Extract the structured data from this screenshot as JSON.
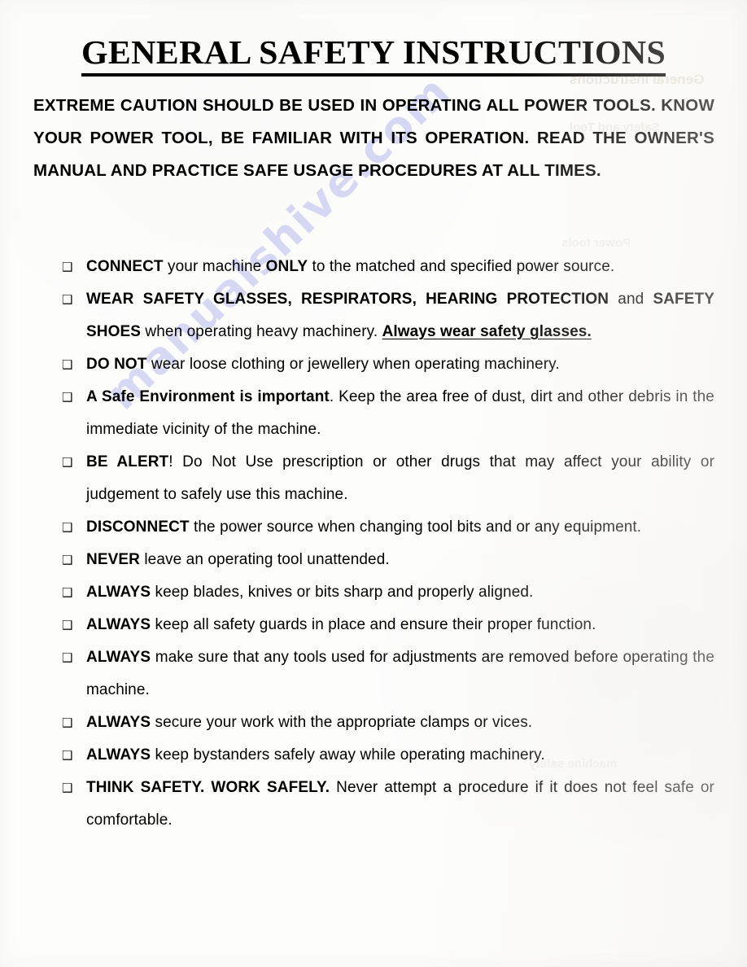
{
  "document": {
    "title": "GENERAL SAFETY INSTRUCTIONS",
    "intro": "EXTREME CAUTION SHOULD BE USED IN OPERATING ALL POWER TOOLS. KNOW YOUR POWER TOOL, BE FAMILIAR WITH ITS OPERATION. READ THE OWNER'S MANUAL AND PRACTICE SAFE USAGE PROCEDURES AT ALL TIMES.",
    "bullet_marker": "❑",
    "watermark": "manualshive.com",
    "ghost_text": {
      "line1": "General Instructions",
      "line2": "Safety and Tool",
      "line3": "Power tools",
      "line4": "machine safety"
    },
    "bullets": [
      {
        "id": "connect",
        "parts": [
          {
            "text": "CONNECT",
            "style": "bold"
          },
          {
            "text": " your machine ",
            "style": "normal"
          },
          {
            "text": "ONLY",
            "style": "bold"
          },
          {
            "text": " to the matched and specified power source.",
            "style": "normal"
          }
        ]
      },
      {
        "id": "wear-safety-glasses",
        "parts": [
          {
            "text": "WEAR SAFETY GLASSES, RESPIRATORS, HEARING PROTECTION",
            "style": "bold"
          },
          {
            "text": " and ",
            "style": "normal"
          },
          {
            "text": "SAFETY SHOES",
            "style": "bold"
          },
          {
            "text": " when operating heavy machinery. ",
            "style": "normal"
          },
          {
            "text": "Always wear safety glasses.",
            "style": "bold-underline"
          }
        ]
      },
      {
        "id": "do-not-loose-clothing",
        "parts": [
          {
            "text": "DO NOT",
            "style": "bold"
          },
          {
            "text": " wear loose clothing or jewellery when operating machinery.",
            "style": "normal"
          }
        ]
      },
      {
        "id": "safe-environment",
        "parts": [
          {
            "text": "A Safe Environment is important",
            "style": "bold"
          },
          {
            "text": ". Keep the area free of dust, dirt and other debris in the immediate vicinity of the machine.",
            "style": "normal"
          }
        ]
      },
      {
        "id": "be-alert",
        "parts": [
          {
            "text": "BE ALERT",
            "style": "bold"
          },
          {
            "text": "! Do Not Use prescription or other drugs that may affect your ability or judgement to safely use this machine.",
            "style": "normal"
          }
        ]
      },
      {
        "id": "disconnect",
        "parts": [
          {
            "text": "DISCONNECT",
            "style": "bold"
          },
          {
            "text": " the power source when changing tool bits and or any equipment.",
            "style": "normal"
          }
        ]
      },
      {
        "id": "never-unattended",
        "parts": [
          {
            "text": "NEVER",
            "style": "bold"
          },
          {
            "text": " leave an operating tool unattended.",
            "style": "normal"
          }
        ]
      },
      {
        "id": "always-sharp-blades",
        "parts": [
          {
            "text": "ALWAYS",
            "style": "bold"
          },
          {
            "text": " keep blades, knives or bits sharp and properly aligned.",
            "style": "normal"
          }
        ]
      },
      {
        "id": "always-safety-guards",
        "parts": [
          {
            "text": "ALWAYS",
            "style": "bold"
          },
          {
            "text": " keep all safety guards in place and ensure their proper function.",
            "style": "normal"
          }
        ]
      },
      {
        "id": "always-remove-tools",
        "parts": [
          {
            "text": "ALWAYS",
            "style": "bold"
          },
          {
            "text": " make sure that any tools used for adjustments are removed before operating the machine.",
            "style": "normal"
          }
        ]
      },
      {
        "id": "always-secure-work",
        "parts": [
          {
            "text": "ALWAYS",
            "style": "bold"
          },
          {
            "text": " secure your work with the appropriate clamps or vices.",
            "style": "normal"
          }
        ]
      },
      {
        "id": "always-bystanders",
        "parts": [
          {
            "text": "ALWAYS",
            "style": "bold"
          },
          {
            "text": " keep bystanders safely away while operating machinery.",
            "style": "normal"
          }
        ]
      },
      {
        "id": "think-safety",
        "parts": [
          {
            "text": "THINK SAFETY. WORK SAFELY.",
            "style": "bold"
          },
          {
            "text": " Never attempt a procedure if it does not feel safe or comfortable.",
            "style": "normal"
          }
        ]
      }
    ]
  }
}
